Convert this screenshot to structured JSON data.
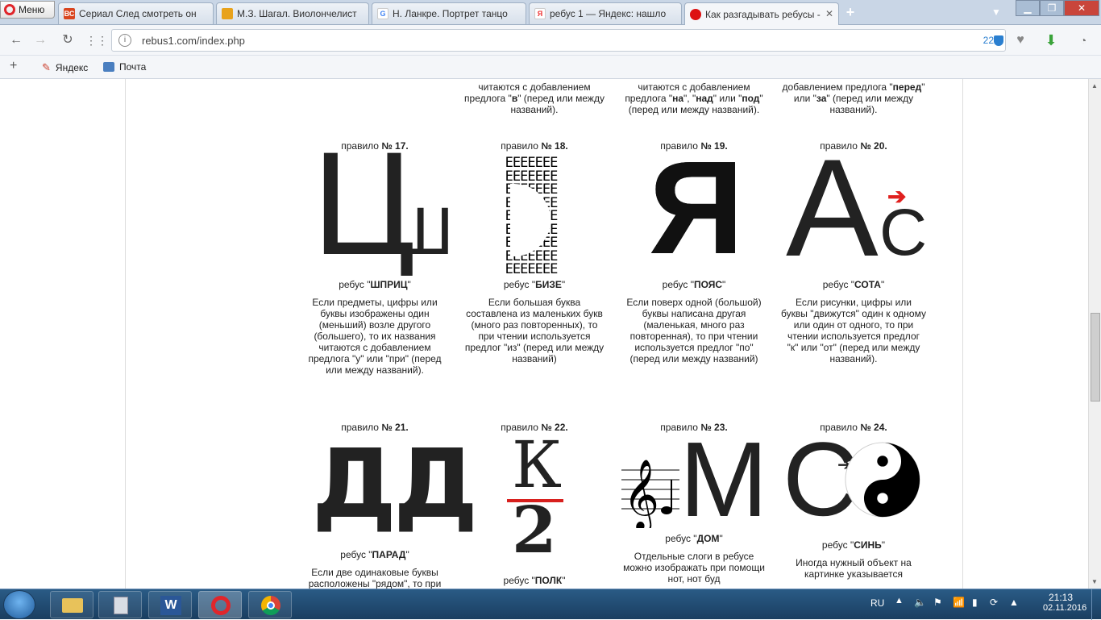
{
  "browser": {
    "menu_label": "Меню",
    "tabs": [
      {
        "title": "Сериал След смотреть он",
        "favicon": "ВС",
        "color": "#d9451f"
      },
      {
        "title": "М.З. Шагал. Виолончелист",
        "favicon": "",
        "color": "#e8a21b"
      },
      {
        "title": "Н. Ланкре. Портрет танцо",
        "favicon": "G",
        "color": "#ffffff"
      },
      {
        "title": "ребус 1 — Яндекс: нашло",
        "favicon": "Я",
        "color": "#e33"
      },
      {
        "title": "Как разгадывать ребусы -",
        "favicon": "",
        "color": "#d11"
      }
    ],
    "url": "rebus1.com/index.php",
    "badge_count": "22",
    "bookmarks": [
      "Яндекс",
      "Почта"
    ]
  },
  "rebus": {
    "top_fragments": [
      {
        "pre": "читаются с добавлением предлога ",
        "b1": "в",
        "post": " (перед или между названий)."
      },
      {
        "pre": "читаются с добавлением предлога ",
        "b1": "на",
        "mid": ", ",
        "b2": "над",
        "mid2": " или ",
        "b3": "под",
        "post": " (перед или между названий)."
      },
      {
        "pre": "добавлением предлога ",
        "b1": "перед",
        "mid": " или ",
        "b2": "за",
        "post": " (перед или между названий)."
      }
    ],
    "rules": [
      {
        "num": "№ 17.",
        "answer": "ШПРИЦ",
        "desc": "Если предметы, цифры или буквы изображены один (меньший) возле другого (большего), то их названия читаются с добавлением предлога \"у\" или \"при\" (перед или между названий)."
      },
      {
        "num": "№ 18.",
        "answer": "БИЗЕ",
        "desc": "Если большая буква составлена из маленьких букв (много раз повторенных), то при чтении используется предлог \"из\" (перед или между названий)"
      },
      {
        "num": "№ 19.",
        "answer": "ПОЯС",
        "desc": "Если поверх одной (большой) буквы написана другая (маленькая, много раз повторенная), то при чтении используется предлог \"по\" (перед или между названий)"
      },
      {
        "num": "№ 20.",
        "answer": "СОТА",
        "desc": "Если рисунки, цифры или буквы \"движутся\" один к одному или один от одного, то при чтении используется предлог \"к\" или \"от\" (перед или между названий)."
      },
      {
        "num": "№ 21.",
        "answer": "ПАРАД",
        "desc": "Если две одинаковые буквы расположены \"рядом\", то при"
      },
      {
        "num": "№ 22.",
        "answer": "ПОЛК",
        "desc": ""
      },
      {
        "num": "№ 23.",
        "answer": "ДОМ",
        "desc": "Отдельные слоги в ребусе можно изображать при помощи нот, нот буд"
      },
      {
        "num": "№ 24.",
        "answer": "СИНЬ",
        "desc": "Иногда нужный объект на картинке указывается"
      }
    ],
    "rule_prefix": "правило",
    "answer_prefix": "ребус",
    "glyphs": {
      "r17a": "Ц",
      "r17b": "Ш",
      "r18": "ЕЕЕЕЕЕЕ",
      "r19": "Я",
      "r20a": "А",
      "r20b": "С",
      "r21": "ДД",
      "r22a": "К",
      "r22b": "2",
      "r23": "М",
      "r24": "С"
    }
  },
  "taskbar": {
    "lang": "RU",
    "time": "21:13",
    "date": "02.11.2016"
  }
}
